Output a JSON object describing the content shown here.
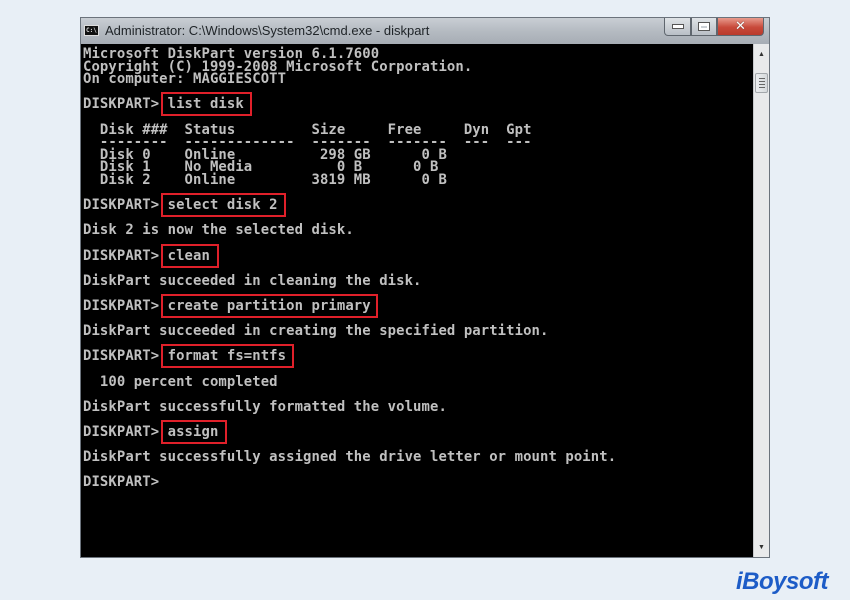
{
  "window": {
    "title": "Administrator: C:\\Windows\\System32\\cmd.exe - diskpart",
    "app_icon": "cmd-icon",
    "buttons": {
      "minimize": "minimize",
      "maximize": "maximize",
      "close": "close"
    }
  },
  "console": {
    "lines": [
      "Microsoft DiskPart version 6.1.7600",
      "Copyright (C) 1999-2008 Microsoft Corporation.",
      "On computer: MAGGIESCOTT",
      "",
      "DISKPART> list disk",
      "",
      "  Disk ###  Status         Size     Free     Dyn  Gpt",
      "  --------  -------------  -------  -------  ---  ---",
      "  Disk 0    Online          298 GB      0 B",
      "  Disk 1    No Media          0 B      0 B",
      "  Disk 2    Online         3819 MB      0 B",
      "",
      "DISKPART> select disk 2",
      "",
      "Disk 2 is now the selected disk.",
      "",
      "DISKPART> clean",
      "",
      "DiskPart succeeded in cleaning the disk.",
      "",
      "DISKPART> create partition primary",
      "",
      "DiskPart succeeded in creating the specified partition.",
      "",
      "DISKPART> format fs=ntfs",
      "",
      "  100 percent completed",
      "",
      "DiskPart successfully formatted the volume.",
      "",
      "DISKPART> assign",
      "",
      "DiskPart successfully assigned the drive letter or mount point.",
      "",
      "DISKPART>"
    ],
    "highlighted_commands": [
      "list disk",
      "select disk 2",
      "clean",
      "create partition primary",
      "format fs=ntfs",
      "assign"
    ],
    "disk_table": {
      "columns": [
        "Disk ###",
        "Status",
        "Size",
        "Free",
        "Dyn",
        "Gpt"
      ],
      "rows": [
        [
          "Disk 0",
          "Online",
          "298 GB",
          "0 B",
          "",
          ""
        ],
        [
          "Disk 1",
          "No Media",
          "0 B",
          "0 B",
          "",
          ""
        ],
        [
          "Disk 2",
          "Online",
          "3819 MB",
          "0 B",
          "",
          ""
        ]
      ]
    }
  },
  "highlight_color": "#e0202a",
  "brand": {
    "name": "iBoysoft",
    "color": "#1d5cc7"
  }
}
